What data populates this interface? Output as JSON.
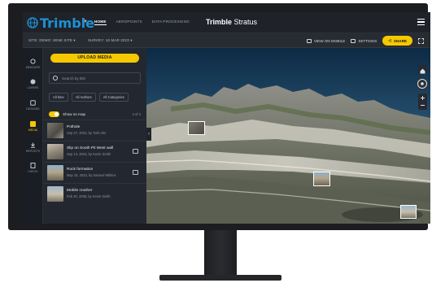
{
  "app": {
    "brand": "Trimble",
    "title_bold": "Trimble",
    "title_light": "Stratus"
  },
  "nav": {
    "tabs": [
      {
        "label": "HOME",
        "active": true
      },
      {
        "label": "AEROPOINTS",
        "active": false
      },
      {
        "label": "DATA PROCESSING",
        "active": false
      }
    ]
  },
  "subbar": {
    "site": "SITE:  DEMO: MINE SITE  ▾",
    "survey": "SURVEY:  18 MAR 2023  ▾",
    "view_on_mobile": "VIEW ON MOBILE",
    "settings": "SETTINGS",
    "share": "SHARE"
  },
  "rail": [
    {
      "label": "MEASURE",
      "icon": "measure-icon"
    },
    {
      "label": "LAYERS",
      "icon": "layers-icon"
    },
    {
      "label": "DESIGNS",
      "icon": "designs-icon"
    },
    {
      "label": "MEDIA",
      "icon": "media-icon",
      "active": true
    },
    {
      "label": "REPORTS",
      "icon": "reports-icon"
    },
    {
      "label": "CHECK",
      "icon": "check-icon"
    }
  ],
  "panel": {
    "upload": "UPLOAD MEDIA",
    "search_placeholder": "Search by title",
    "filters": [
      "All time",
      "All Authors",
      "All Categories"
    ],
    "show_on_map": "Show on map",
    "count": "4 of 4",
    "items": [
      {
        "title": "Pothole",
        "sub": "Sep 27, 2023, by Tosh Alis",
        "comment": false
      },
      {
        "title": "Slip on South Pit West wall",
        "sub": "Sep 13, 2023, by Kevin Smith",
        "comment": true
      },
      {
        "title": "Rock formation",
        "sub": "May 15, 2023, by Samuel Wilkins",
        "comment": true
      },
      {
        "title": "Mobile crusher",
        "sub": "Feb 20, 2008, by Kevin Smith",
        "comment": false
      }
    ]
  },
  "colors": {
    "accent": "#f5c800",
    "brand_blue": "#1e90d6",
    "bar": "#1f2329"
  }
}
